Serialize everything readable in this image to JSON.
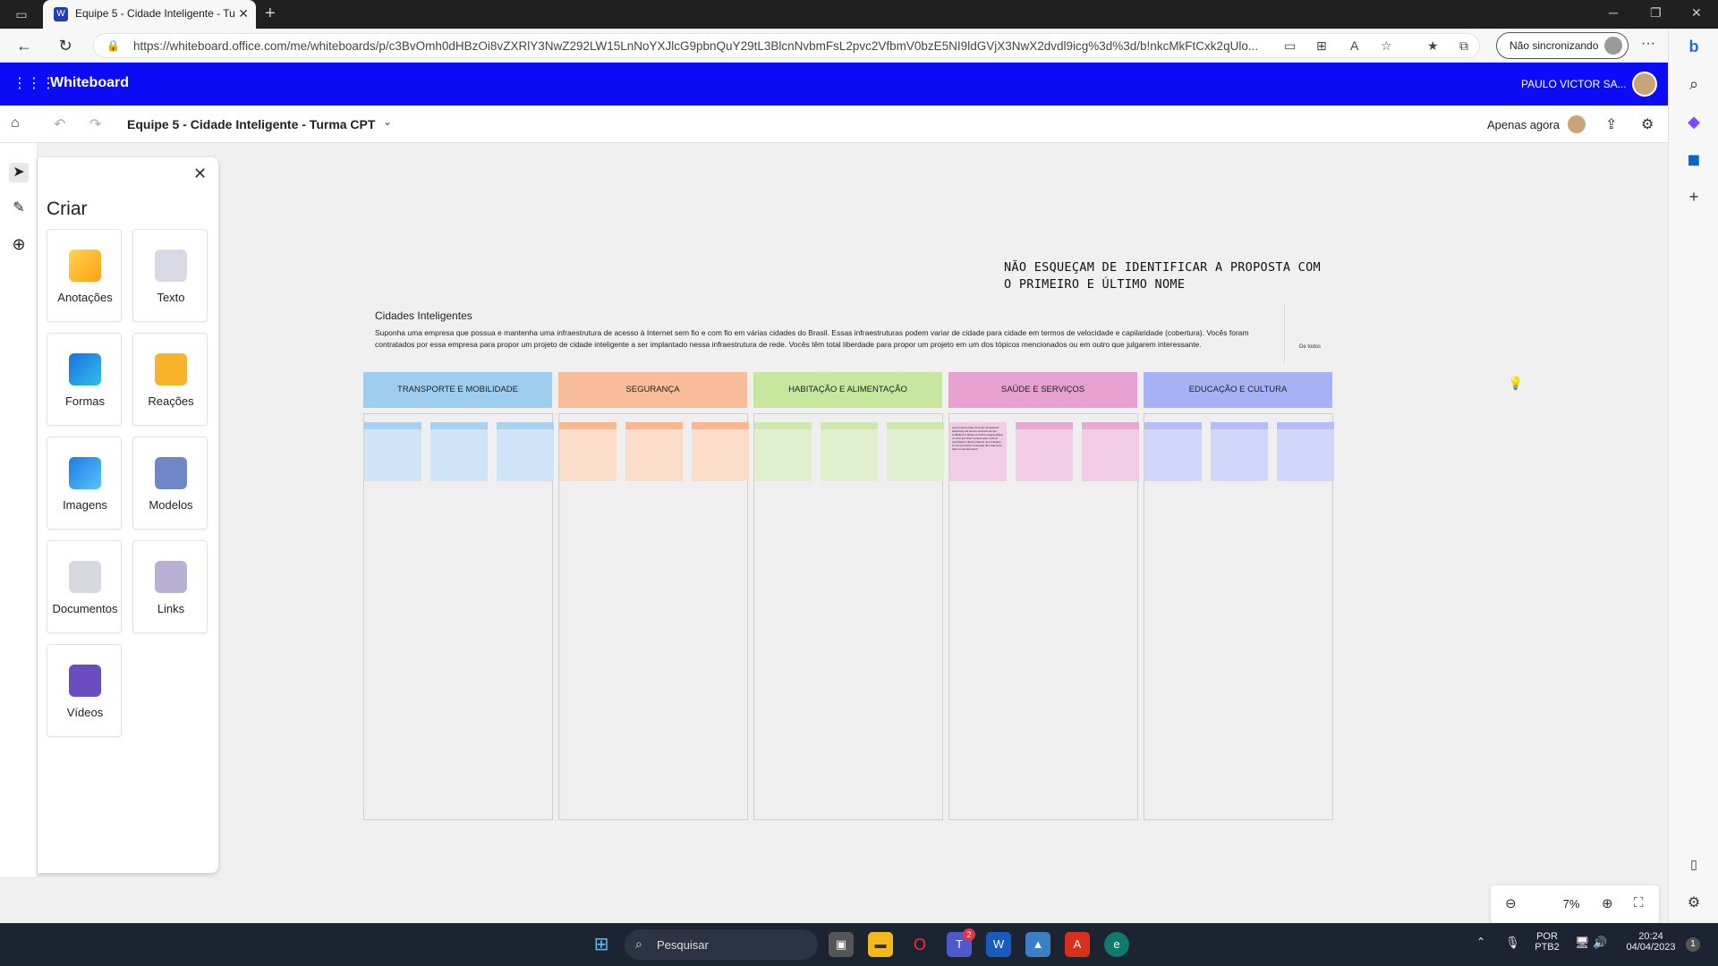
{
  "browser": {
    "tab_title": "Equipe 5 - Cidade Inteligente - Tu",
    "url": "https://whiteboard.office.com/me/whiteboards/p/c3BvOmh0dHBzOi8vZXRlY3NwZ292LW15LnNoYXJlcG9pbnQuY29tL3BlcnNvbmFsL2pvc2VfbmV0bzE5NI9ldGVjX3NwX2dvdl9icg%3d%3d/b!nkcMkFtCxk2qUlo...",
    "sync_label": "Não sincronizando"
  },
  "app": {
    "name": "Whiteboard",
    "user_name": "PAULO VICTOR SA..."
  },
  "toolbar": {
    "board_title": "Equipe 5 - Cidade Inteligente - Turma CPT",
    "saved_status": "Apenas agora"
  },
  "create_panel": {
    "title": "Criar",
    "items": [
      {
        "label": "Anotações",
        "icon": "sticky-note-icon"
      },
      {
        "label": "Texto",
        "icon": "text-icon"
      },
      {
        "label": "Formas",
        "icon": "shapes-icon"
      },
      {
        "label": "Reações",
        "icon": "thumbs-up-icon"
      },
      {
        "label": "Imagens",
        "icon": "image-icon"
      },
      {
        "label": "Modelos",
        "icon": "template-icon"
      },
      {
        "label": "Documentos",
        "icon": "document-icon"
      },
      {
        "label": "Links",
        "icon": "link-icon"
      },
      {
        "label": "Vídeos",
        "icon": "video-icon"
      }
    ]
  },
  "board": {
    "reminder_line1": "NÃO ESQUEÇAM DE IDENTIFICAR A PROPOSTA COM",
    "reminder_line2": "O PRIMEIRO E ÚLTIMO NOME",
    "brief_title": "Cidades Inteligentes",
    "brief_text": "Suponha uma empresa que possua e mantenha uma infraestrutura de acesso à Internet sem fio e com fio em várias cidades do Brasil. Essas infraestruturas podem variar de cidade para cidade em termos de velocidade e capilaridade (cobertura). Vocês foram contratados por essa empresa para propor um projeto de cidade inteligente a ser implantado nessa infraestrutura de rede. Vocês têm total liberdade para propor um projeto em um dos tópicos mencionados ou em outro que julgarem interessante.",
    "brief_aside": "De todos",
    "filled_note_text": "Lorem ipsum dolor sit amet consectetur adipiscing elit sed do eiusmod tempor incididunt ut labore et dolore magna aliqua ut enim ad minim veniam quis nostrud exercitation ullamco laboris nisi ut aliquip ex ea commodo consequat duis aute irure dolor in reprehenderit",
    "columns": [
      {
        "title": "TRANSPORTE E MOBILIDADE",
        "header_color": "#9fcdef",
        "note_color": "#cfe4f6",
        "strip_color": "#a9d2f1"
      },
      {
        "title": "SEGURANÇA",
        "header_color": "#f9bc9a",
        "note_color": "#fbdcc9",
        "strip_color": "#f7b892"
      },
      {
        "title": "HABITAÇÃO E ALIMENTAÇÃO",
        "header_color": "#c7e69e",
        "note_color": "#e0f0cf",
        "strip_color": "#cde8ae"
      },
      {
        "title": "SAÚDE E SERVIÇOS",
        "header_color": "#e6a1d0",
        "note_color": "#f2cbe4",
        "strip_color": "#e7a8d3"
      },
      {
        "title": "EDUCAÇÃO E CULTURA",
        "header_color": "#a6b2f4",
        "note_color": "#d2d6f8",
        "strip_color": "#b4bdf6"
      }
    ]
  },
  "zoom": {
    "level": "7%"
  },
  "taskbar": {
    "search_label": "Pesquisar",
    "lang_line1": "POR",
    "lang_line2": "PTB2",
    "time": "20:24",
    "date": "04/04/2023",
    "notification_count": "1",
    "teams_badge": "2"
  }
}
